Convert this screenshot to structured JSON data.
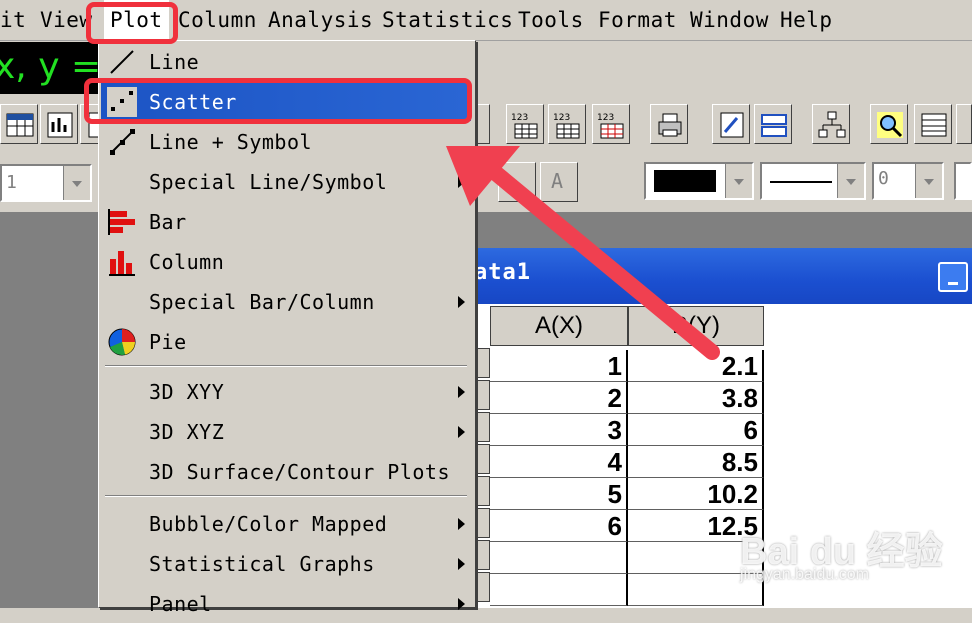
{
  "menubar": {
    "items": [
      "it",
      "View",
      "Plot",
      "Column",
      "Analysis",
      "Statistics",
      "Tools",
      "Format",
      "Window",
      "Help"
    ],
    "active": "Plot"
  },
  "coord_display": "x, y = ?",
  "toolbar_fields": {
    "font_size": "1",
    "line_width": "0"
  },
  "colors": {
    "highlight": "#1c54c4",
    "annotation": "#f0303c",
    "coord_text": "#22e022",
    "title_bar": "#1b4fd0"
  },
  "plot_menu": {
    "items": [
      {
        "label": "Line",
        "icon": "line-plot-icon",
        "submenu": false
      },
      {
        "label": "Scatter",
        "icon": "scatter-plot-icon",
        "submenu": false,
        "highlighted": true
      },
      {
        "label": "Line + Symbol",
        "icon": "line-symbol-plot-icon",
        "submenu": false
      },
      {
        "label": "Special Line/Symbol",
        "icon": "",
        "submenu": true
      },
      {
        "label": "Bar",
        "icon": "bar-chart-icon",
        "submenu": false
      },
      {
        "label": "Column",
        "icon": "column-chart-icon",
        "submenu": false
      },
      {
        "label": "Special Bar/Column",
        "icon": "",
        "submenu": true
      },
      {
        "label": "Pie",
        "icon": "pie-chart-icon",
        "submenu": false
      },
      {
        "label": "3D XYY",
        "icon": "",
        "submenu": true
      },
      {
        "label": "3D XYZ",
        "icon": "",
        "submenu": true
      },
      {
        "label": "3D Surface/Contour Plots",
        "icon": "",
        "submenu": false
      },
      {
        "label": "Bubble/Color Mapped",
        "icon": "",
        "submenu": true
      },
      {
        "label": "Statistical Graphs",
        "icon": "",
        "submenu": true
      },
      {
        "label": "Panel",
        "icon": "",
        "submenu": true
      }
    ]
  },
  "worksheet": {
    "title": "ata1",
    "columns": [
      "A(X)",
      "B(Y)"
    ],
    "rows": [
      [
        "1",
        "2.1"
      ],
      [
        "2",
        "3.8"
      ],
      [
        "3",
        "6"
      ],
      [
        "4",
        "8.5"
      ],
      [
        "5",
        "10.2"
      ],
      [
        "6",
        "12.5"
      ]
    ]
  },
  "watermark": {
    "main": "Bai du 经验",
    "sub": "jingyan.baidu.com"
  }
}
